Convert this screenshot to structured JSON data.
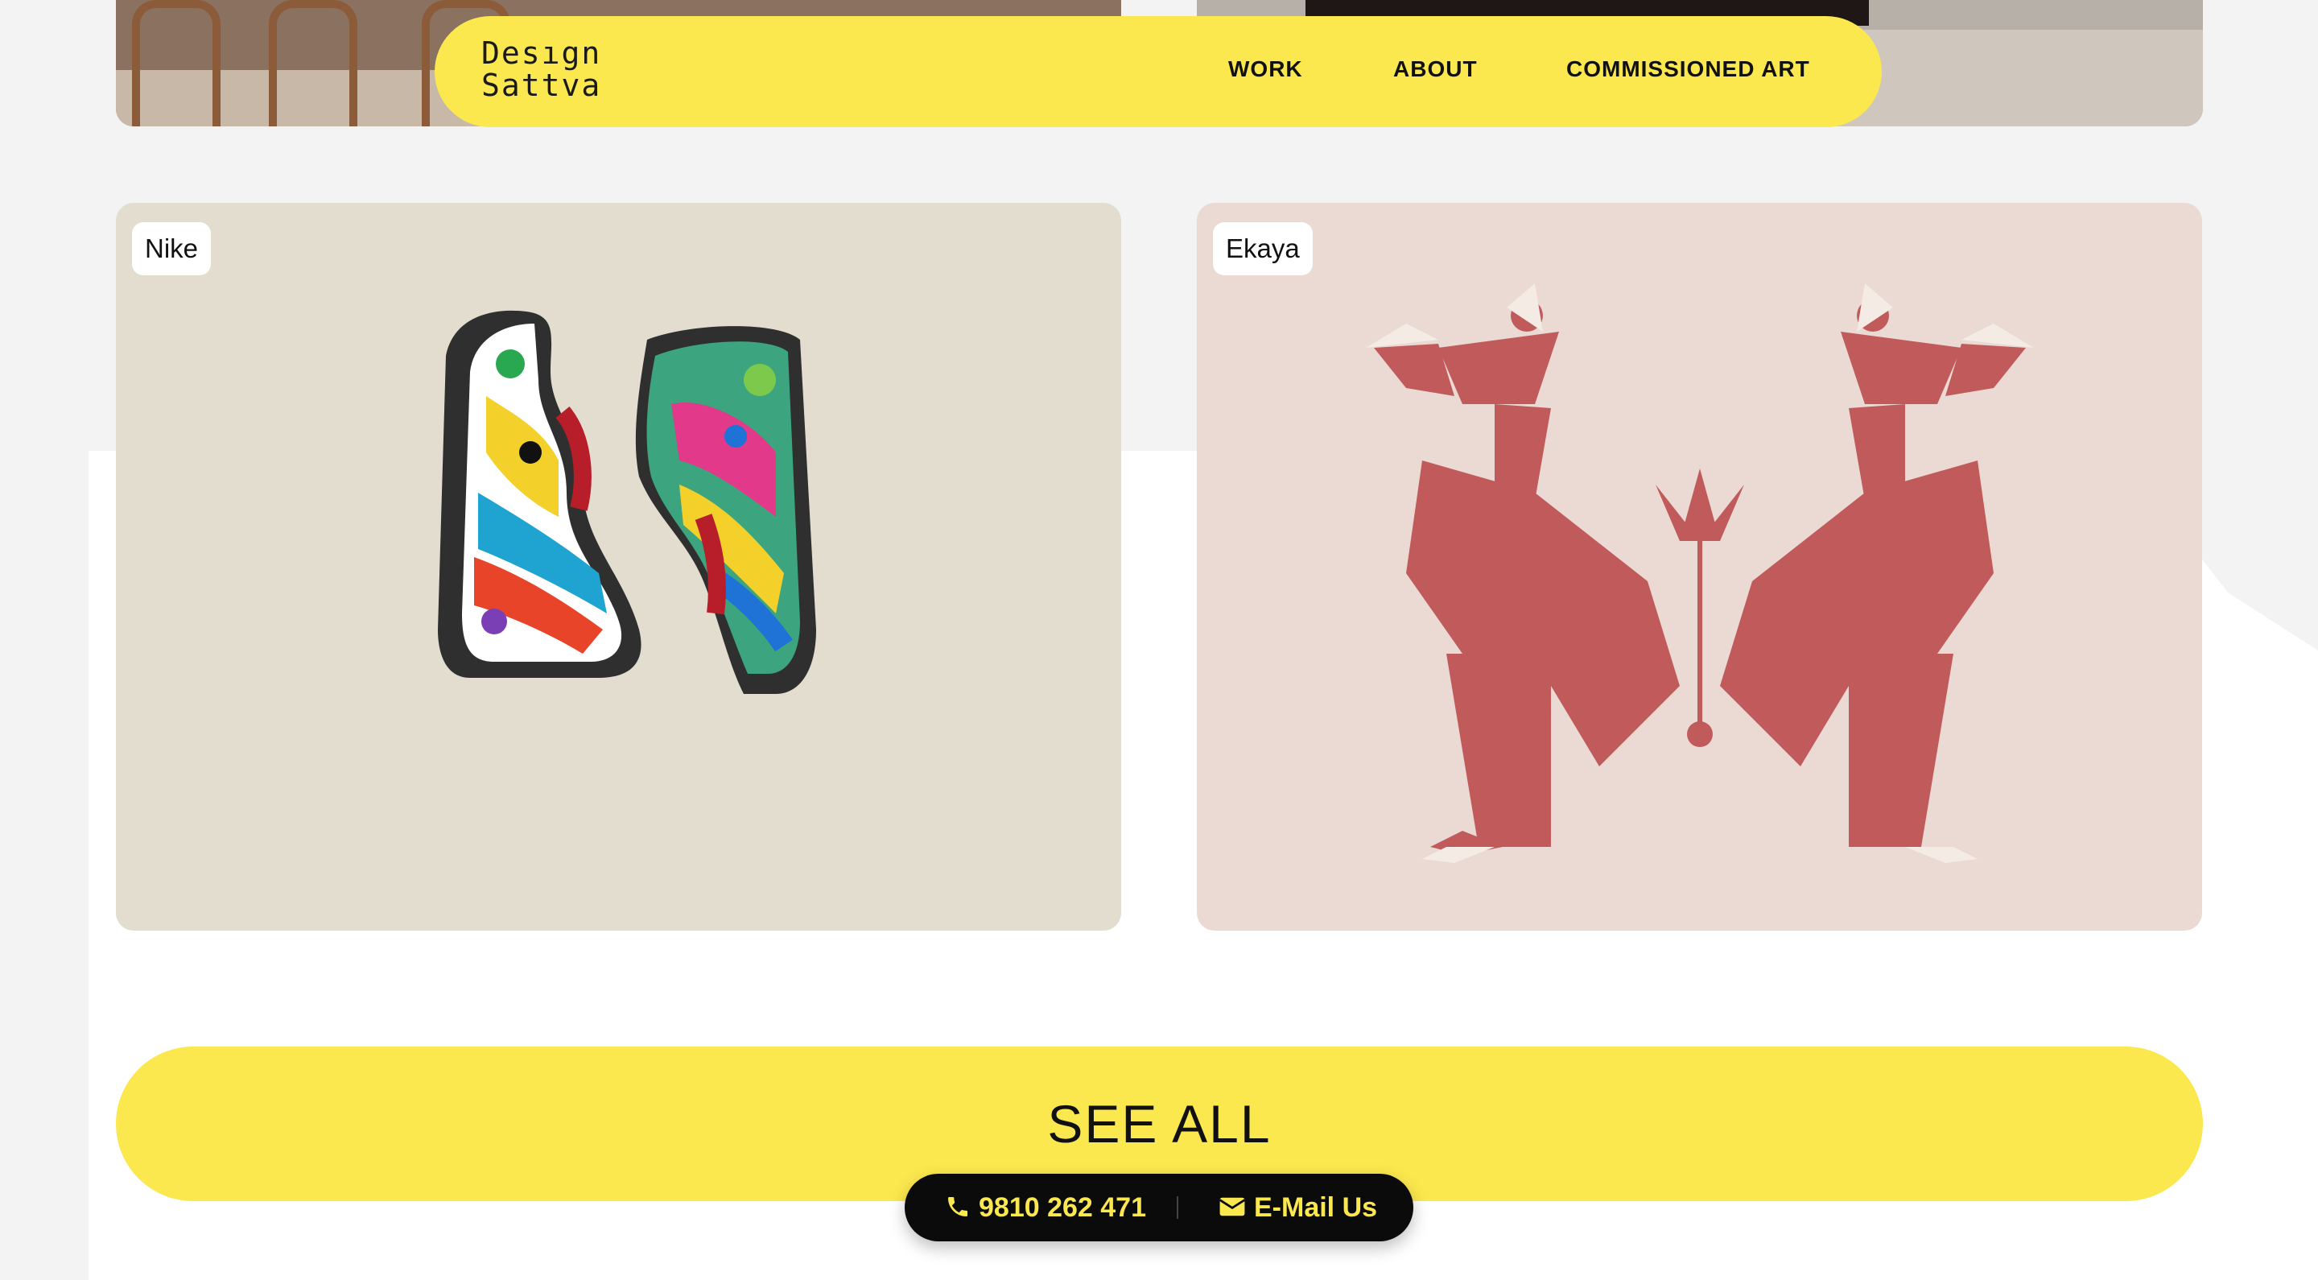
{
  "brand": {
    "logo_line1": "Desıgn",
    "logo_line2": "Sattva"
  },
  "nav": {
    "work": "WORK",
    "about": "ABOUT",
    "commissioned": "COMMISSIONED ART"
  },
  "projects": [
    {
      "label": "Nike"
    },
    {
      "label": "Ekaya"
    }
  ],
  "cta": {
    "see_all": "SEE ALL"
  },
  "contact": {
    "phone": "9810 262 471",
    "email": "E-Mail Us"
  },
  "colors": {
    "accent": "#fbe84e",
    "dark": "#0b0b0b",
    "ekaya_red": "#c05a5b"
  },
  "icons": {
    "phone": "phone-icon",
    "email": "envelope-icon"
  }
}
